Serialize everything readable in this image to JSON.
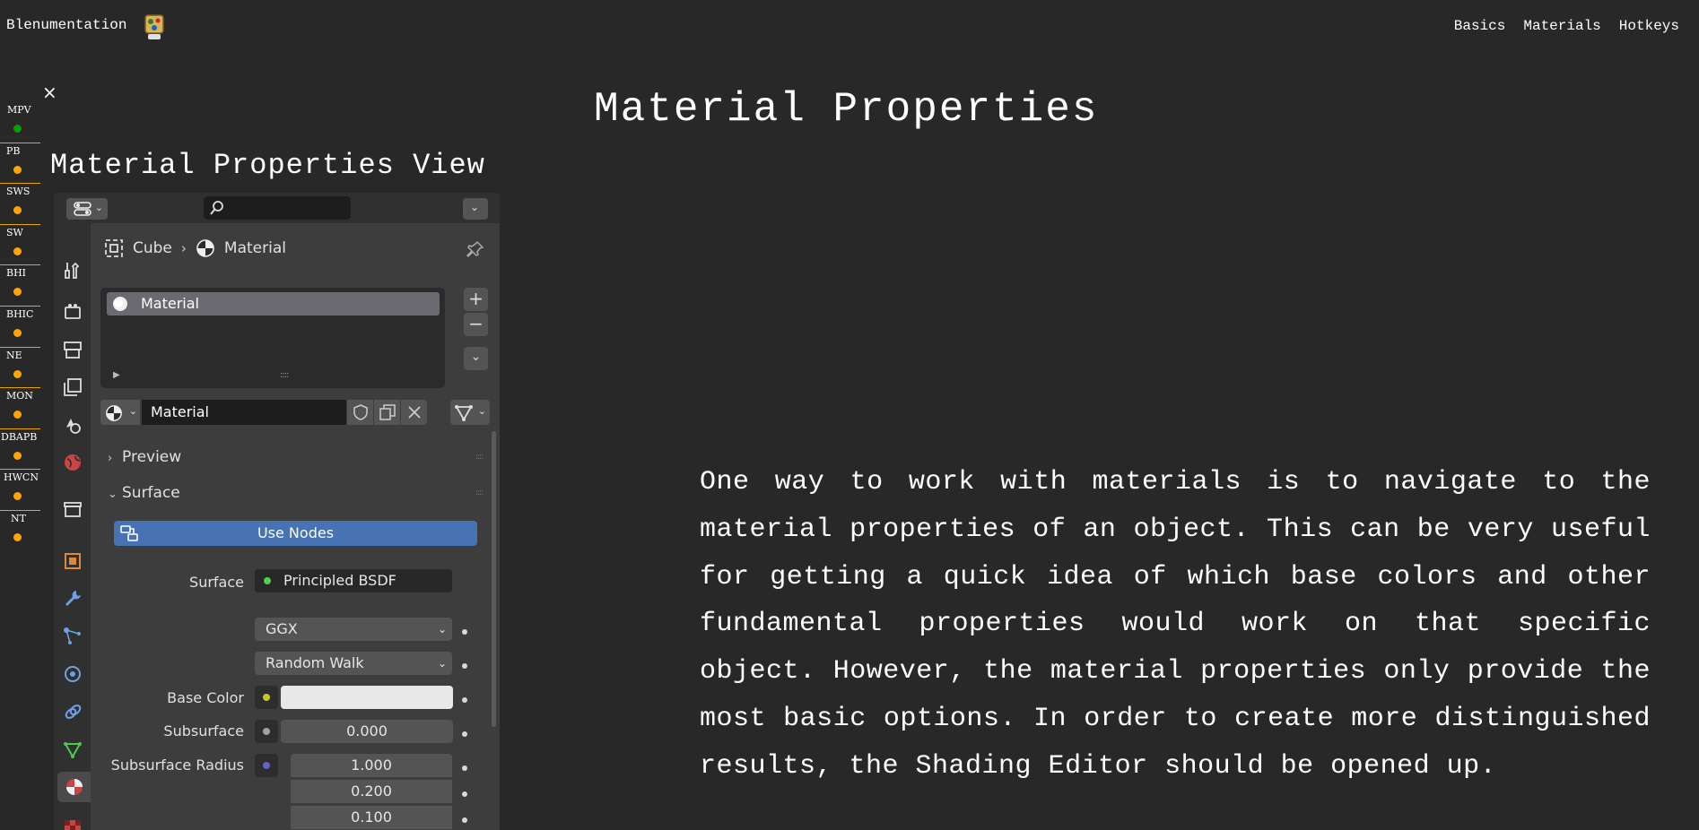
{
  "site": {
    "brand": "Blenumentation",
    "nav": [
      "Basics",
      "Materials",
      "Hotkeys"
    ]
  },
  "page": {
    "title": "Material Properties",
    "close_icon": "×",
    "section_title": "Material Properties View",
    "paragraph": "One way to work with materials is to navigate to the material properties of an object. This can be very useful for getting a quick idea of which base colors and other fundamental properties would work on that specific object. However, the material properties only provide the most basic options. In order to create more distinguished results, the Shading Editor should be opened up."
  },
  "sidenav": {
    "items": [
      {
        "label": "MPV",
        "status": "active"
      },
      {
        "label": "PB",
        "status": "pending"
      },
      {
        "label": "SWS",
        "status": "pending"
      },
      {
        "label": "SW",
        "status": "pending"
      },
      {
        "label": "BHI",
        "status": "pending"
      },
      {
        "label": "BHIC",
        "status": "pending"
      },
      {
        "label": "NE",
        "status": "pending"
      },
      {
        "label": "MON",
        "status": "pending"
      },
      {
        "label": "DBAPB",
        "status": "pending"
      },
      {
        "label": "HWCN",
        "status": "pending"
      },
      {
        "label": "NT",
        "status": "pending"
      }
    ],
    "colors": {
      "active": "#00a000",
      "pending": "#ffa500",
      "divider": "#e8a400"
    }
  },
  "blender": {
    "breadcrumb": {
      "object": "Cube",
      "material": "Material"
    },
    "slot_name": "Material",
    "slot_add": "+",
    "slot_remove": "−",
    "slot_more": "⌄",
    "datablock_name": "Material",
    "sections": {
      "preview": "Preview",
      "surface": "Surface"
    },
    "use_nodes": "Use Nodes",
    "props": {
      "surface_label": "Surface",
      "surface_value": "Principled BSDF",
      "distribution": "GGX",
      "subsurface_method": "Random Walk",
      "base_color_label": "Base Color",
      "subsurface_label": "Subsurface",
      "subsurface_value": "0.000",
      "subsurface_radius_label": "Subsurface Radius",
      "radius": [
        "1.000",
        "0.200",
        "0.100"
      ]
    },
    "socket_colors": {
      "shader": "#4fd14f",
      "color": "#c7c729",
      "float": "#a1a1a1",
      "vector": "#6363c7"
    },
    "accent": "#4772b3",
    "icons": [
      "editor-type-icon",
      "search-icon",
      "tool-icon",
      "render-icon",
      "output-icon",
      "view-layer-icon",
      "scene-icon",
      "world-icon",
      "collection-icon",
      "object-icon",
      "modifier-icon",
      "particles-icon",
      "physics-icon",
      "constraints-icon",
      "data-icon",
      "material-icon",
      "texture-icon",
      "pin-icon"
    ]
  }
}
